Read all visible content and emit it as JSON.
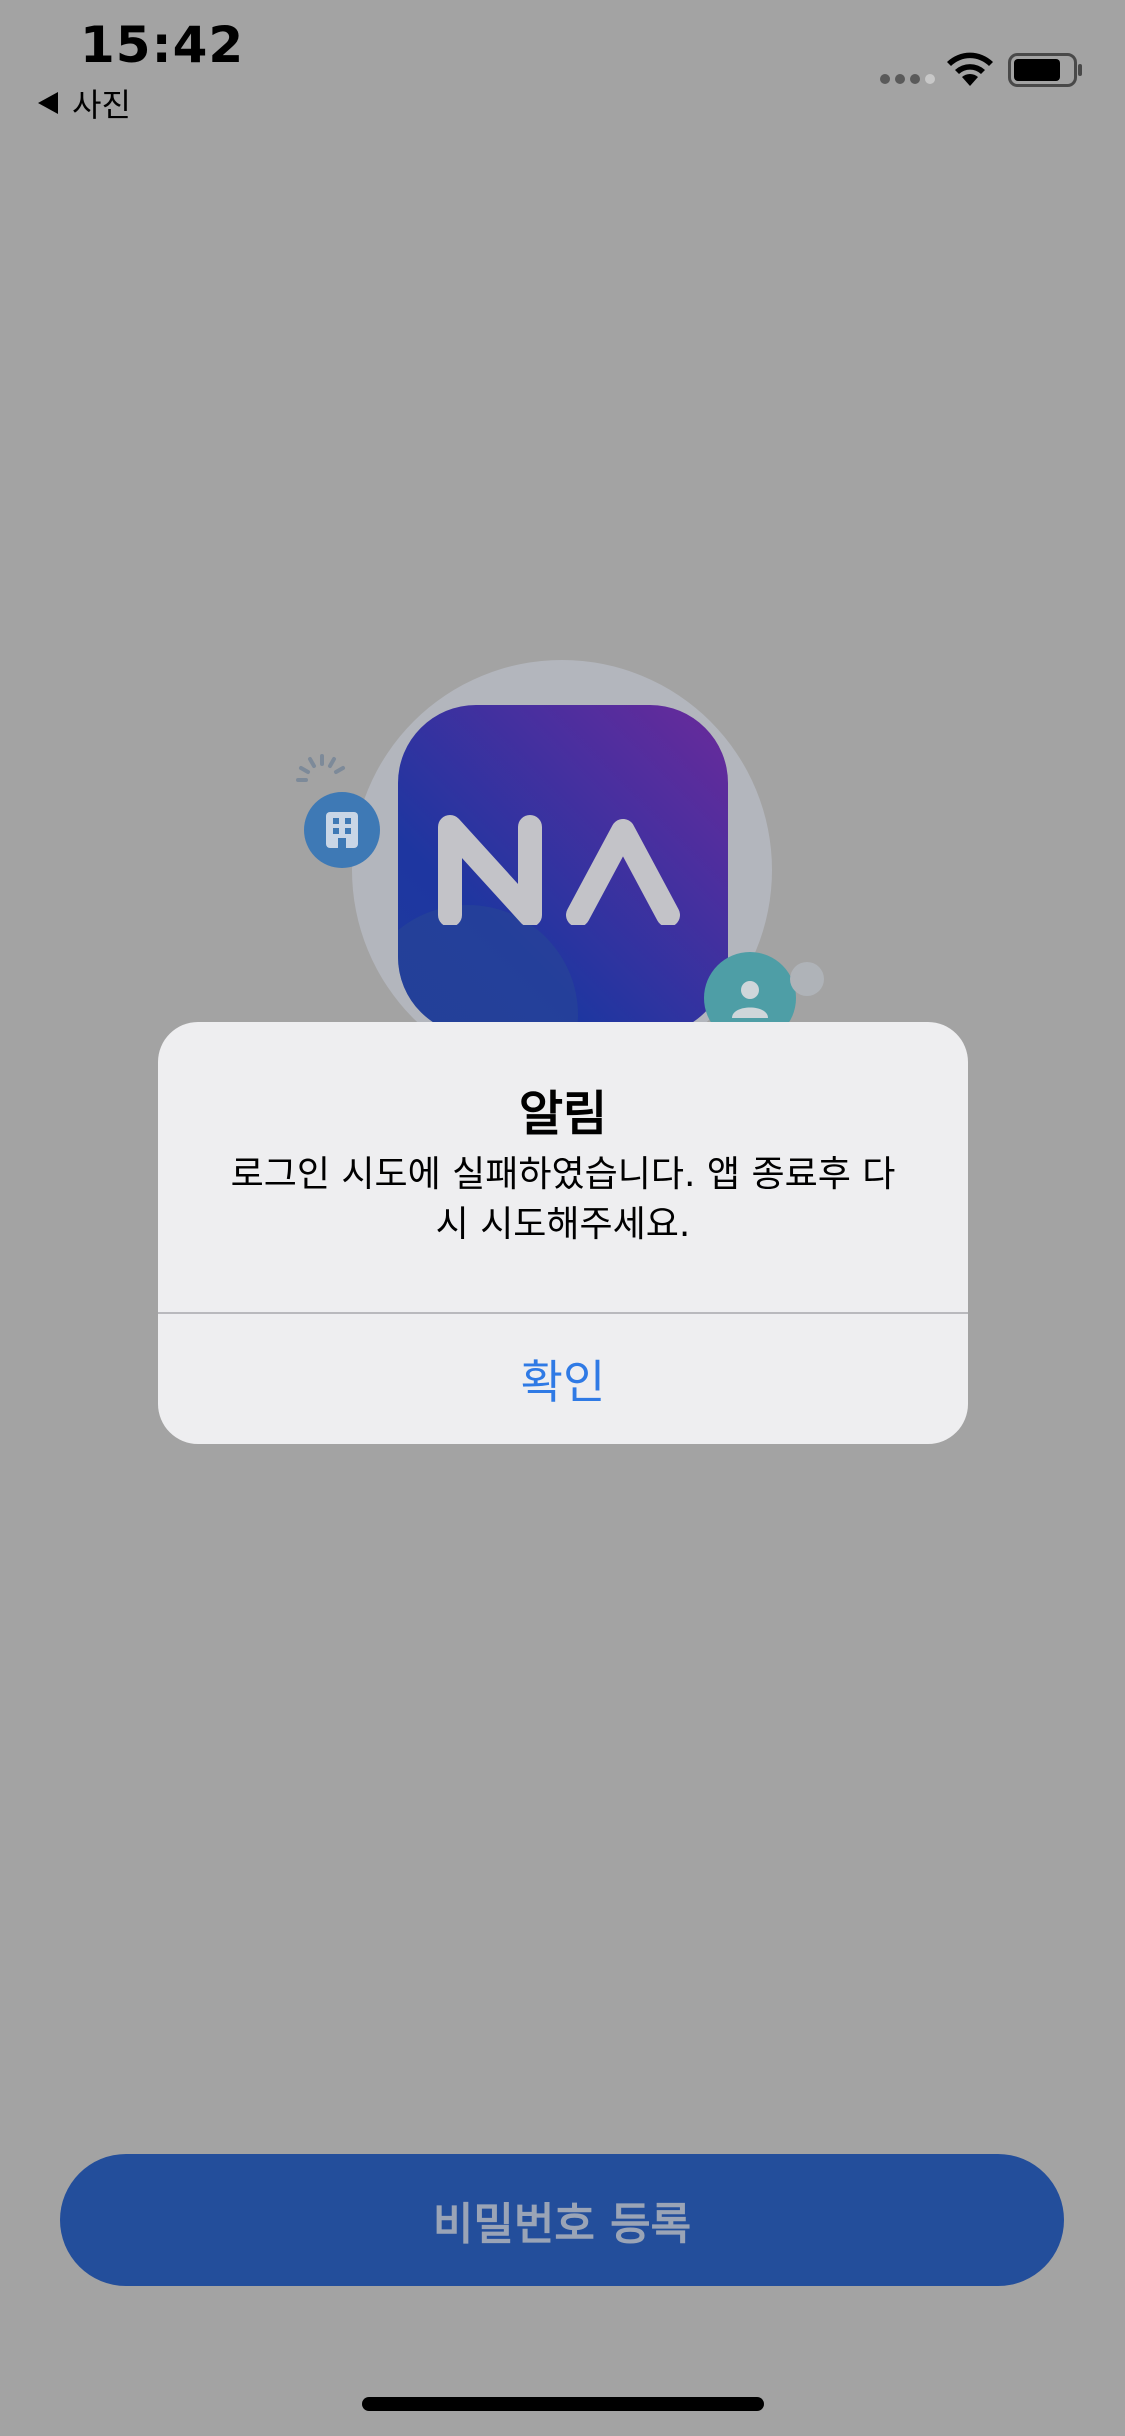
{
  "status_bar": {
    "time": "15:42",
    "back_app_label": "사진"
  },
  "logo": {
    "icon_name": "na-app-logo",
    "letters": "NA"
  },
  "alert": {
    "title": "알림",
    "message": "로그인 시도에 실패하였습니다. 앱 종료후 다시 시도해주세요.",
    "confirm_label": "확인"
  },
  "bottom": {
    "register_password_label": "비밀번호 등록"
  },
  "colors": {
    "overlay_background": "#a3a3a3",
    "alert_background": "#eeeef0",
    "alert_button_text": "#2f7ae5",
    "primary_button": "#234e9b",
    "primary_button_text": "#9aa4b6"
  }
}
